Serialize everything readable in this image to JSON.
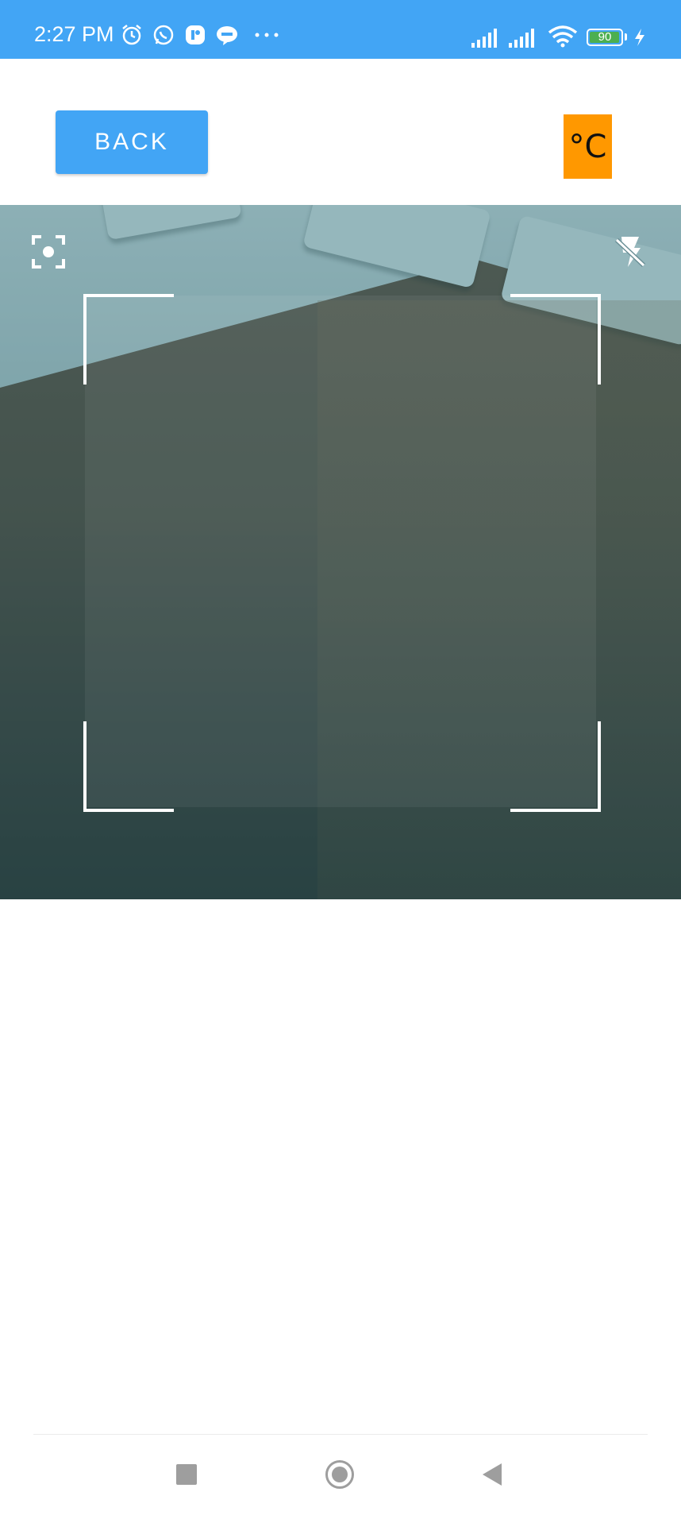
{
  "status_bar": {
    "time": "2:27 PM",
    "icons": [
      "alarm-icon",
      "whatsapp-icon",
      "app-icon",
      "line-icon",
      "more-dots-icon",
      "signal-icon",
      "signal-icon",
      "wifi-icon",
      "battery-icon",
      "charging-icon"
    ],
    "battery_level": "90",
    "colors": {
      "background": "#42a5f5",
      "battery": "#4caf50"
    }
  },
  "toolbar": {
    "back_label": "BACK",
    "unit_label": "°C",
    "colors": {
      "back": "#42a5f5",
      "unit": "#ff9800"
    }
  },
  "scanner": {
    "left_icon": "focus-icon",
    "right_icon": "flash-off-icon"
  },
  "navigation": {
    "icons": [
      "recent-apps-icon",
      "home-icon",
      "back-icon"
    ]
  }
}
